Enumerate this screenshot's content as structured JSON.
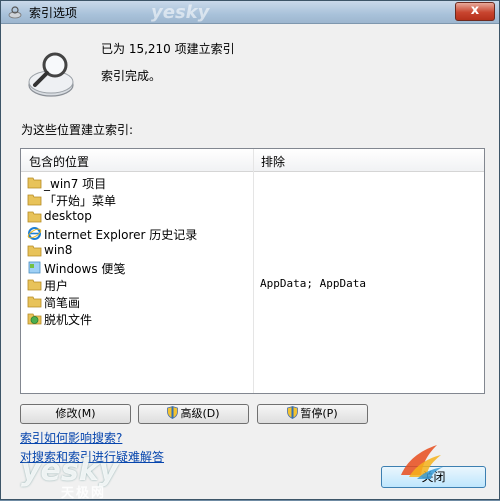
{
  "window": {
    "title": "索引选项",
    "close_glyph": "x"
  },
  "header": {
    "indexed_count_line": "已为 15,210 项建立索引",
    "status_line": "索引完成。"
  },
  "section_label": "为这些位置建立索引:",
  "list": {
    "columns": {
      "included": "包含的位置",
      "excluded": "排除"
    },
    "rows": [
      {
        "icon": "folder-icon",
        "label": "_win7 项目",
        "excluded": ""
      },
      {
        "icon": "folder-icon",
        "label": "「开始」菜单",
        "excluded": ""
      },
      {
        "icon": "folder-icon",
        "label": "desktop",
        "excluded": ""
      },
      {
        "icon": "internet-explorer-icon",
        "label": "Internet Explorer 历史记录",
        "excluded": ""
      },
      {
        "icon": "folder-icon",
        "label": "win8",
        "excluded": ""
      },
      {
        "icon": "windows-note-icon",
        "label": "Windows 便笺",
        "excluded": ""
      },
      {
        "icon": "folder-icon",
        "label": "用户",
        "excluded": "AppData; AppData"
      },
      {
        "icon": "folder-icon",
        "label": "简笔画",
        "excluded": ""
      },
      {
        "icon": "offline-files-icon",
        "label": "脱机文件",
        "excluded": ""
      }
    ]
  },
  "buttons": {
    "modify": "修改(M)",
    "advanced": "高级(D)",
    "pause": "暂停(P)",
    "close": "关闭"
  },
  "links": {
    "how_indexing_affects_search": "索引如何影响搜索?",
    "troubleshoot": "对搜索和索引进行疑难解答"
  },
  "watermarks": {
    "top": "yesky",
    "bottom": "yesky",
    "bottom_sub": "天极网"
  },
  "colors": {
    "link": "#0645ad",
    "titlebar": "#a9c2da",
    "folder": "#e8c35a"
  }
}
